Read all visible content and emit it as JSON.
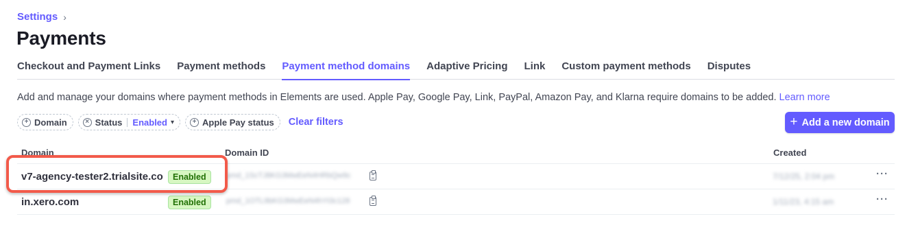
{
  "breadcrumb": {
    "parent": "Settings",
    "separator": "›"
  },
  "page": {
    "title": "Payments"
  },
  "tabs": [
    {
      "label": "Checkout and Payment Links",
      "active": false
    },
    {
      "label": "Payment methods",
      "active": false
    },
    {
      "label": "Payment method domains",
      "active": true
    },
    {
      "label": "Adaptive Pricing",
      "active": false
    },
    {
      "label": "Link",
      "active": false
    },
    {
      "label": "Custom payment methods",
      "active": false
    },
    {
      "label": "Disputes",
      "active": false
    }
  ],
  "description": {
    "text": "Add and manage your domains where payment methods in Elements are used. Apple Pay, Google Pay, Link, PayPal, Amazon Pay, and Klarna require domains to be added.",
    "link": "Learn more"
  },
  "filters": {
    "domain": "Domain",
    "status": "Status",
    "status_value": "Enabled",
    "apple_pay": "Apple Pay status",
    "clear": "Clear filters"
  },
  "actions": {
    "add_domain": "Add a new domain"
  },
  "table": {
    "columns": {
      "domain": "Domain",
      "domain_id": "Domain ID",
      "created": "Created"
    },
    "rows": [
      {
        "domain": "v7-agency-tester2.trialsite.co",
        "status": "Enabled",
        "domain_id": "pmd_1ScTJ8KG3MwEeN4HRbQw9c",
        "created": "7/12/25, 2:04 pm"
      },
      {
        "domain": "in.xero.com",
        "status": "Enabled",
        "domain_id": "pmd_1OTL9bKG3MwEeN4hYt3c128",
        "created": "1/11/23, 4:15 am"
      }
    ]
  },
  "colors": {
    "accent": "#635bff",
    "highlight": "#f25a4a",
    "badge_bg": "#d7f7c2",
    "badge_text": "#217005"
  }
}
